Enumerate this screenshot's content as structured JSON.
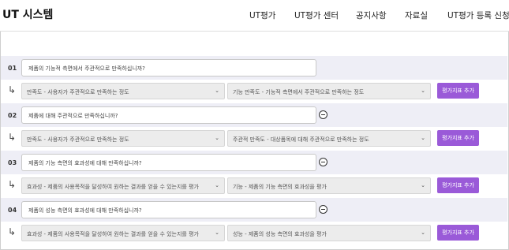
{
  "brand": "UT 시스템",
  "nav": [
    "UT평가",
    "UT평가 센터",
    "공지사항",
    "자료실",
    "UT평가 등록 신청"
  ],
  "questions": [
    {
      "num": "01",
      "text": "제품의 기능적 측면에서 주관적으로 만족하십니까?",
      "has_remove": false,
      "metric1": "만족도 - 사용자가 주관적으로 만족하는 정도",
      "metric2": "기능 만족도 - 기능적 측면에서 주관적으로 만족하는 정도",
      "add_label": "평가지표 추가"
    },
    {
      "num": "02",
      "text": "제품에 대해 주관적으로 만족하십니까?",
      "has_remove": true,
      "metric1": "만족도 - 사용자가 주관적으로 만족하는 정도",
      "metric2": "주관적 만족도 - 대상품목에 대해 주관적으로 만족하는 정도",
      "add_label": "평가지표 추가"
    },
    {
      "num": "03",
      "text": "제품의 기능 측면의 효과성에 대해 만족하십니까?",
      "has_remove": true,
      "metric1": "효과성 - 제품의 사용목적을 달성하여 원하는 결과를 얻을 수 있는지를 평가",
      "metric2": "기능 - 제품의 기능 측면의 효과성을 평가",
      "add_label": "평가지표 추가"
    },
    {
      "num": "04",
      "text": "제품의 성능 측면의 효과성에 대해 만족하십니까?",
      "has_remove": true,
      "metric1": "효과성 - 제품의 사용목적을 달성하여 원하는 결과를 얻을 수 있는지를 평가",
      "metric2": "성능 - 제품의 성능 측면의 효과성을 평가",
      "add_label": "평가지표 추가"
    }
  ],
  "colors": {
    "accent": "#9a5ad8",
    "question_row_bg": "#eeeef6"
  }
}
